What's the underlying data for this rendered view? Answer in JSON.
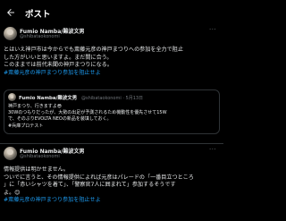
{
  "header": {
    "title": "ポスト"
  },
  "post1": {
    "name": "Fumio Namba/難波文男",
    "handle": "@shibataokonomi",
    "lines": [
      "とはいえ神戸市は今からでも斎藤元彦の神戸まつりへの参加を全力で阻止",
      "した方がいいと思いますよ。まだ間に合う。",
      "このままでは前代未聞の神戸まつりになる。"
    ],
    "hashtag": "#斎藤元彦の神戸まつり参加を阻止せよ"
  },
  "quote": {
    "name": "Fumio Namba/難波文男",
    "handle": "@shibataokonomi · 5月13日",
    "lines": [
      "神戸まつり、行きますよ😎",
      "30Wのつもりだったが、大勢の出足が予測されるため機動性を優先させて15W",
      "で、そのぶりEVOLTA NEOの新品を装填しておく。",
      "#兵庫プロテスト"
    ]
  },
  "post2": {
    "name": "Fumio Namba/難波文男",
    "handle": "@shibataokonomi",
    "lines": [
      "情報提供は明かせません。",
      "ついでに言うと、その情報提供によれば元彦はパレードの「一番目立つところ",
      "」に「赤いシャツを着て」、「警察官7人に囲まれて」参加するそうです",
      "よ。😊"
    ],
    "hashtag": "#斎藤元彦の神戸まつり参加を阻止せよ"
  },
  "icons": {
    "back": "arrow-left-icon",
    "more": "more-horizontal-icon"
  },
  "colors": {
    "background": "#000000",
    "link": "#1d9bf0",
    "muted": "#71767b",
    "text": "#e7e9ea"
  }
}
